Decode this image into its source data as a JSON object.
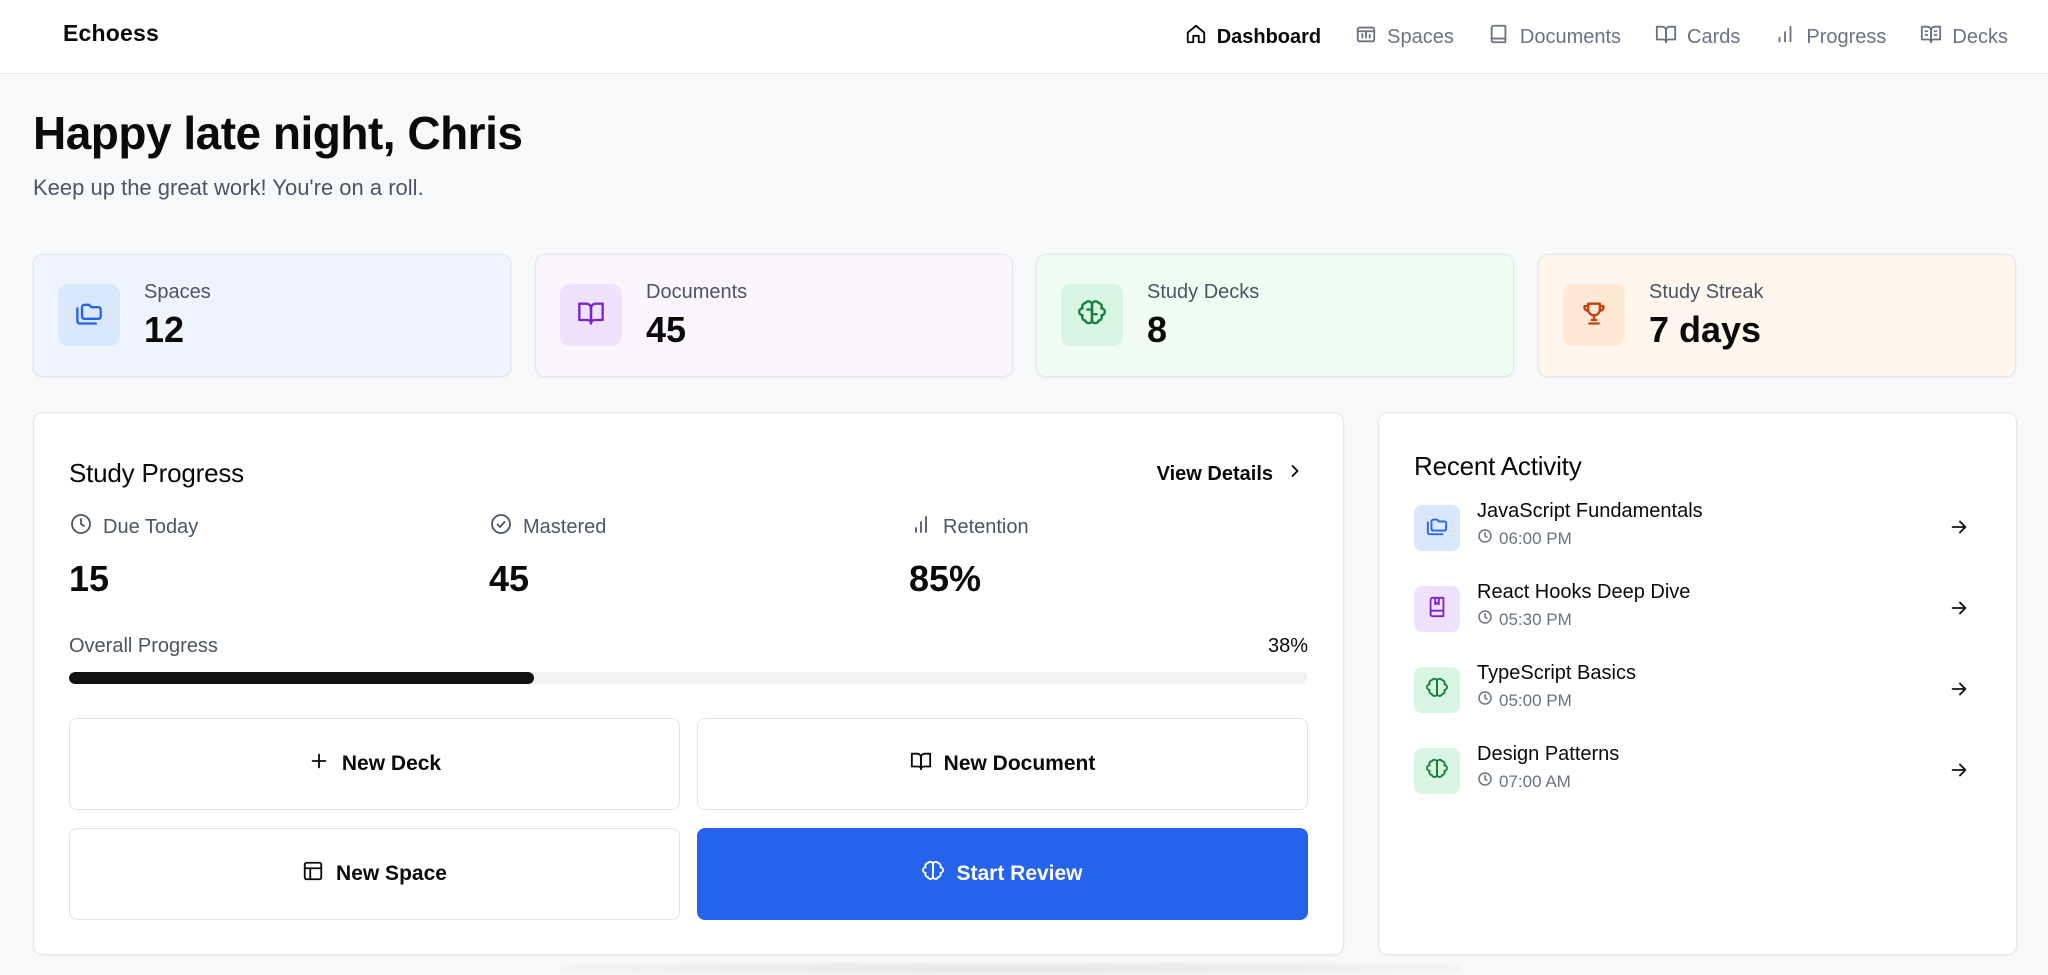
{
  "brand": "Echoess",
  "nav": [
    {
      "label": "Dashboard",
      "icon": "home-icon",
      "active": true
    },
    {
      "label": "Spaces",
      "icon": "spaces-icon",
      "active": false
    },
    {
      "label": "Documents",
      "icon": "document-icon",
      "active": false
    },
    {
      "label": "Cards",
      "icon": "book-icon",
      "active": false
    },
    {
      "label": "Progress",
      "icon": "bar-chart-icon",
      "active": false
    },
    {
      "label": "Decks",
      "icon": "book-open-text-icon",
      "active": false
    }
  ],
  "greeting": "Happy late night, Chris",
  "subtitle": "Keep up the great work! You're on a roll.",
  "stats": [
    {
      "label": "Spaces",
      "value": "12",
      "icon": "folders-icon",
      "bg": "#eff5ff",
      "icon_bg": "#dbe7fd",
      "icon_color": "#2563eb"
    },
    {
      "label": "Documents",
      "value": "45",
      "icon": "book-open-icon",
      "bg": "#faf5ff",
      "icon_bg": "#efe2fc",
      "icon_color": "#7e22ce"
    },
    {
      "label": "Study Decks",
      "value": "8",
      "icon": "brain-icon",
      "bg": "#effdf3",
      "icon_bg": "#d9f6e2",
      "icon_color": "#15803d"
    },
    {
      "label": "Study Streak",
      "value": "7 days",
      "icon": "trophy-icon",
      "bg": "#fff6ee",
      "icon_bg": "#ffe9d4",
      "icon_color": "#c2410c"
    }
  ],
  "study_progress": {
    "title": "Study Progress",
    "view_details": "View Details",
    "metrics": [
      {
        "label": "Due Today",
        "value": "15",
        "icon": "clock-icon"
      },
      {
        "label": "Mastered",
        "value": "45",
        "icon": "check-circle-icon"
      },
      {
        "label": "Retention",
        "value": "85%",
        "icon": "bar-chart-icon"
      }
    ],
    "overall_label": "Overall Progress",
    "overall_pct_text": "38%",
    "overall_fraction": 0.375
  },
  "actions": [
    {
      "label": "New Deck",
      "icon": "plus-icon",
      "primary": false
    },
    {
      "label": "New Document",
      "icon": "book-open-icon",
      "primary": false
    },
    {
      "label": "New Space",
      "icon": "layout-icon",
      "primary": false
    },
    {
      "label": "Start Review",
      "icon": "brain-icon",
      "primary": true
    }
  ],
  "recent_activity": {
    "title": "Recent Activity",
    "items": [
      {
        "title": "JavaScript Fundamentals",
        "time": "06:00 PM",
        "icon": "folders-icon",
        "icon_bg": "#dbe7fd",
        "icon_color": "#2563eb"
      },
      {
        "title": "React Hooks Deep Dive",
        "time": "05:30 PM",
        "icon": "book-marked-icon",
        "icon_bg": "#efe2fc",
        "icon_color": "#7e22ce"
      },
      {
        "title": "TypeScript Basics",
        "time": "05:00 PM",
        "icon": "brain-icon",
        "icon_bg": "#d9f6e2",
        "icon_color": "#15803d"
      },
      {
        "title": "Design Patterns",
        "time": "07:00 AM",
        "icon": "brain-icon",
        "icon_bg": "#d9f6e2",
        "icon_color": "#15803d"
      }
    ]
  },
  "colors": {
    "accent": "#2563eb",
    "progress_fill": "#111111"
  }
}
